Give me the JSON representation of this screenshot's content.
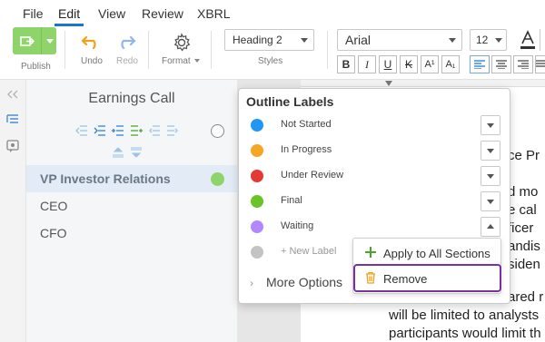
{
  "menu": {
    "items": [
      "File",
      "Edit",
      "View",
      "Review",
      "XBRL"
    ],
    "active": "Edit"
  },
  "toolbar": {
    "publish_label": "Publish",
    "undo_label": "Undo",
    "redo_label": "Redo",
    "format_label": "Format",
    "styles_label": "Styles",
    "style_value": "Heading 2",
    "font_value": "Arial",
    "size_value": "12",
    "format_buttons": [
      "B",
      "I",
      "U",
      "K",
      "A¹",
      "A₁"
    ],
    "accent_color": "#8ed46b"
  },
  "outline": {
    "title": "Earnings Call",
    "sections": [
      {
        "label": "VP Investor Relations",
        "selected": true,
        "dot_color": "#8ed46b"
      },
      {
        "label": "CEO",
        "selected": false
      },
      {
        "label": "CFO",
        "selected": false
      }
    ]
  },
  "popup": {
    "title": "Outline Labels",
    "labels": [
      {
        "name": "Not Started",
        "color": "#2196f3"
      },
      {
        "name": "In Progress",
        "color": "#f5a623"
      },
      {
        "name": "Under Review",
        "color": "#e53935"
      },
      {
        "name": "Final",
        "color": "#6ac425"
      },
      {
        "name": "Waiting",
        "color": "#b388ff"
      }
    ],
    "new_label": "+ New Label",
    "new_label_color": "#c4c4c4",
    "more_options": "More Options"
  },
  "submenu": {
    "apply_all": "Apply to All Sections",
    "remove": "Remove"
  },
  "document": {
    "lines": [
      "ce Pr",
      "d mo",
      "e cal",
      "ficer",
      "andis",
      "siden",
      "ared r",
      "will be limited to analysts",
      "participants would limit th"
    ]
  }
}
